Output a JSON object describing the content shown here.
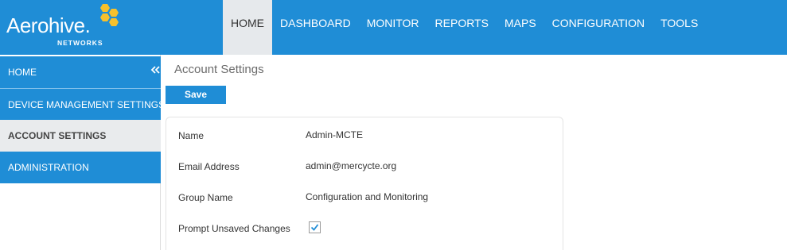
{
  "brand": {
    "name": "Aerohive.",
    "sub": "NETWORKS",
    "accent": "#1f8dd6",
    "logo_color": "#f7c12c"
  },
  "nav": {
    "items": [
      {
        "label": "HOME",
        "active": true
      },
      {
        "label": "DASHBOARD"
      },
      {
        "label": "MONITOR"
      },
      {
        "label": "REPORTS"
      },
      {
        "label": "MAPS"
      },
      {
        "label": "CONFIGURATION"
      },
      {
        "label": "TOOLS"
      }
    ]
  },
  "sidebar": {
    "collapse_icon": "double-chevron-left-icon",
    "items": [
      {
        "label": "HOME"
      },
      {
        "label": "DEVICE MANAGEMENT SETTINGS"
      },
      {
        "label": "ACCOUNT SETTINGS",
        "active": true
      },
      {
        "label": "ADMINISTRATION"
      }
    ]
  },
  "main": {
    "title": "Account Settings",
    "save_label": "Save",
    "fields": [
      {
        "label": "Name",
        "value": "Admin-MCTE"
      },
      {
        "label": "Email Address",
        "value": "admin@mercycte.org"
      },
      {
        "label": "Group Name",
        "value": "Configuration and Monitoring"
      },
      {
        "label": "Prompt Unsaved Changes",
        "checked": true
      }
    ]
  }
}
